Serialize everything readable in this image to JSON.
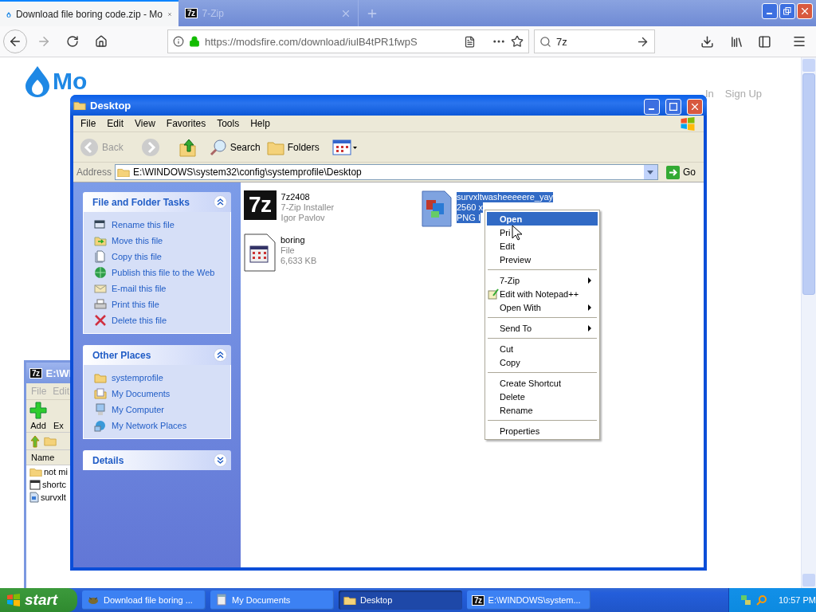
{
  "browser": {
    "tabs": [
      {
        "title": "Download file boring code.zip - Mo",
        "selected": true,
        "kind": "site"
      },
      {
        "title": "7-Zip",
        "selected": false,
        "kind": "sevenzip",
        "logo_text": "7z"
      }
    ],
    "url": "https://modsfire.com/download/iulB4tPR1fwpS",
    "search": {
      "value": "7z"
    }
  },
  "page": {
    "logo": "Mo",
    "nav": [
      "In",
      "Sign Up"
    ]
  },
  "sevenzip_window": {
    "logo_text": "7z",
    "title": "E:\\WI",
    "menu": [
      "File",
      "Edit"
    ],
    "toolbar": [
      "Add",
      "Ex"
    ],
    "column": "Name",
    "rows": [
      {
        "name": "not mi",
        "kind": "folder"
      },
      {
        "name": "shortc",
        "kind": "file"
      },
      {
        "name": "survxlt",
        "kind": "image"
      }
    ]
  },
  "explorer": {
    "title": "Desktop",
    "menu": [
      "File",
      "Edit",
      "View",
      "Favorites",
      "Tools",
      "Help"
    ],
    "toolbar": {
      "back": "Back",
      "search": "Search",
      "folders": "Folders"
    },
    "address_label": "Address",
    "address": "E:\\WINDOWS\\system32\\config\\systemprofile\\Desktop",
    "go": "Go",
    "panels": [
      {
        "title": "File and Folder Tasks",
        "expanded": true,
        "items": [
          {
            "label": "Rename this file",
            "kind": "rename"
          },
          {
            "label": "Move this file",
            "kind": "move"
          },
          {
            "label": "Copy this file",
            "kind": "copy"
          },
          {
            "label": "Publish this file to the Web",
            "kind": "publish"
          },
          {
            "label": "E-mail this file",
            "kind": "email"
          },
          {
            "label": "Print this file",
            "kind": "print"
          },
          {
            "label": "Delete this file",
            "kind": "delete"
          }
        ]
      },
      {
        "title": "Other Places",
        "expanded": true,
        "items": [
          {
            "label": "systemprofile",
            "kind": "folder"
          },
          {
            "label": "My Documents",
            "kind": "documents"
          },
          {
            "label": "My Computer",
            "kind": "computer"
          },
          {
            "label": "My Network Places",
            "kind": "network"
          }
        ]
      },
      {
        "title": "Details",
        "expanded": false
      }
    ],
    "files": [
      {
        "name": "7z2408",
        "lines": [
          "7-Zip Installer",
          "Igor Pavlov"
        ],
        "kind": "sevenzip",
        "logo_text": "7z",
        "selected": false
      },
      {
        "name": "survxltwasheeeeere_yay",
        "lines": [
          "2560 x",
          "PNG I"
        ],
        "kind": "image",
        "selected": true
      },
      {
        "name": "boring",
        "lines": [
          "File",
          "6,633 KB"
        ],
        "kind": "file",
        "selected": false
      }
    ]
  },
  "context_menu": {
    "groups": [
      [
        {
          "label": "Open",
          "selected": true,
          "submenu": false,
          "icon": false
        },
        {
          "label": "Pri",
          "selected": false,
          "submenu": false,
          "icon": false
        },
        {
          "label": "Edit",
          "selected": false,
          "submenu": false,
          "icon": false
        },
        {
          "label": "Preview",
          "selected": false,
          "submenu": false,
          "icon": false
        }
      ],
      [
        {
          "label": "7-Zip",
          "selected": false,
          "submenu": true,
          "icon": false
        },
        {
          "label": "Edit with Notepad++",
          "selected": false,
          "submenu": false,
          "icon": true
        },
        {
          "label": "Open With",
          "selected": false,
          "submenu": true,
          "icon": false
        }
      ],
      [
        {
          "label": "Send To",
          "selected": false,
          "submenu": true,
          "icon": false
        }
      ],
      [
        {
          "label": "Cut",
          "selected": false,
          "submenu": false,
          "icon": false
        },
        {
          "label": "Copy",
          "selected": false,
          "submenu": false,
          "icon": false
        }
      ],
      [
        {
          "label": "Create Shortcut",
          "selected": false,
          "submenu": false,
          "icon": false
        },
        {
          "label": "Delete",
          "selected": false,
          "submenu": false,
          "icon": false
        },
        {
          "label": "Rename",
          "selected": false,
          "submenu": false,
          "icon": false
        }
      ],
      [
        {
          "label": "Properties",
          "selected": false,
          "submenu": false,
          "icon": false
        }
      ]
    ]
  },
  "taskbar": {
    "start": "start",
    "tasks": [
      {
        "label": "Download file boring ...",
        "kind": "browser",
        "selected": false
      },
      {
        "label": "My Documents",
        "kind": "documents",
        "selected": false
      },
      {
        "label": "Desktop",
        "kind": "folder",
        "selected": true
      },
      {
        "label": "E:\\WINDOWS\\system...",
        "kind": "sevenzip",
        "logo_text": "7z",
        "selected": false
      }
    ],
    "clock": "10:57 PM"
  }
}
